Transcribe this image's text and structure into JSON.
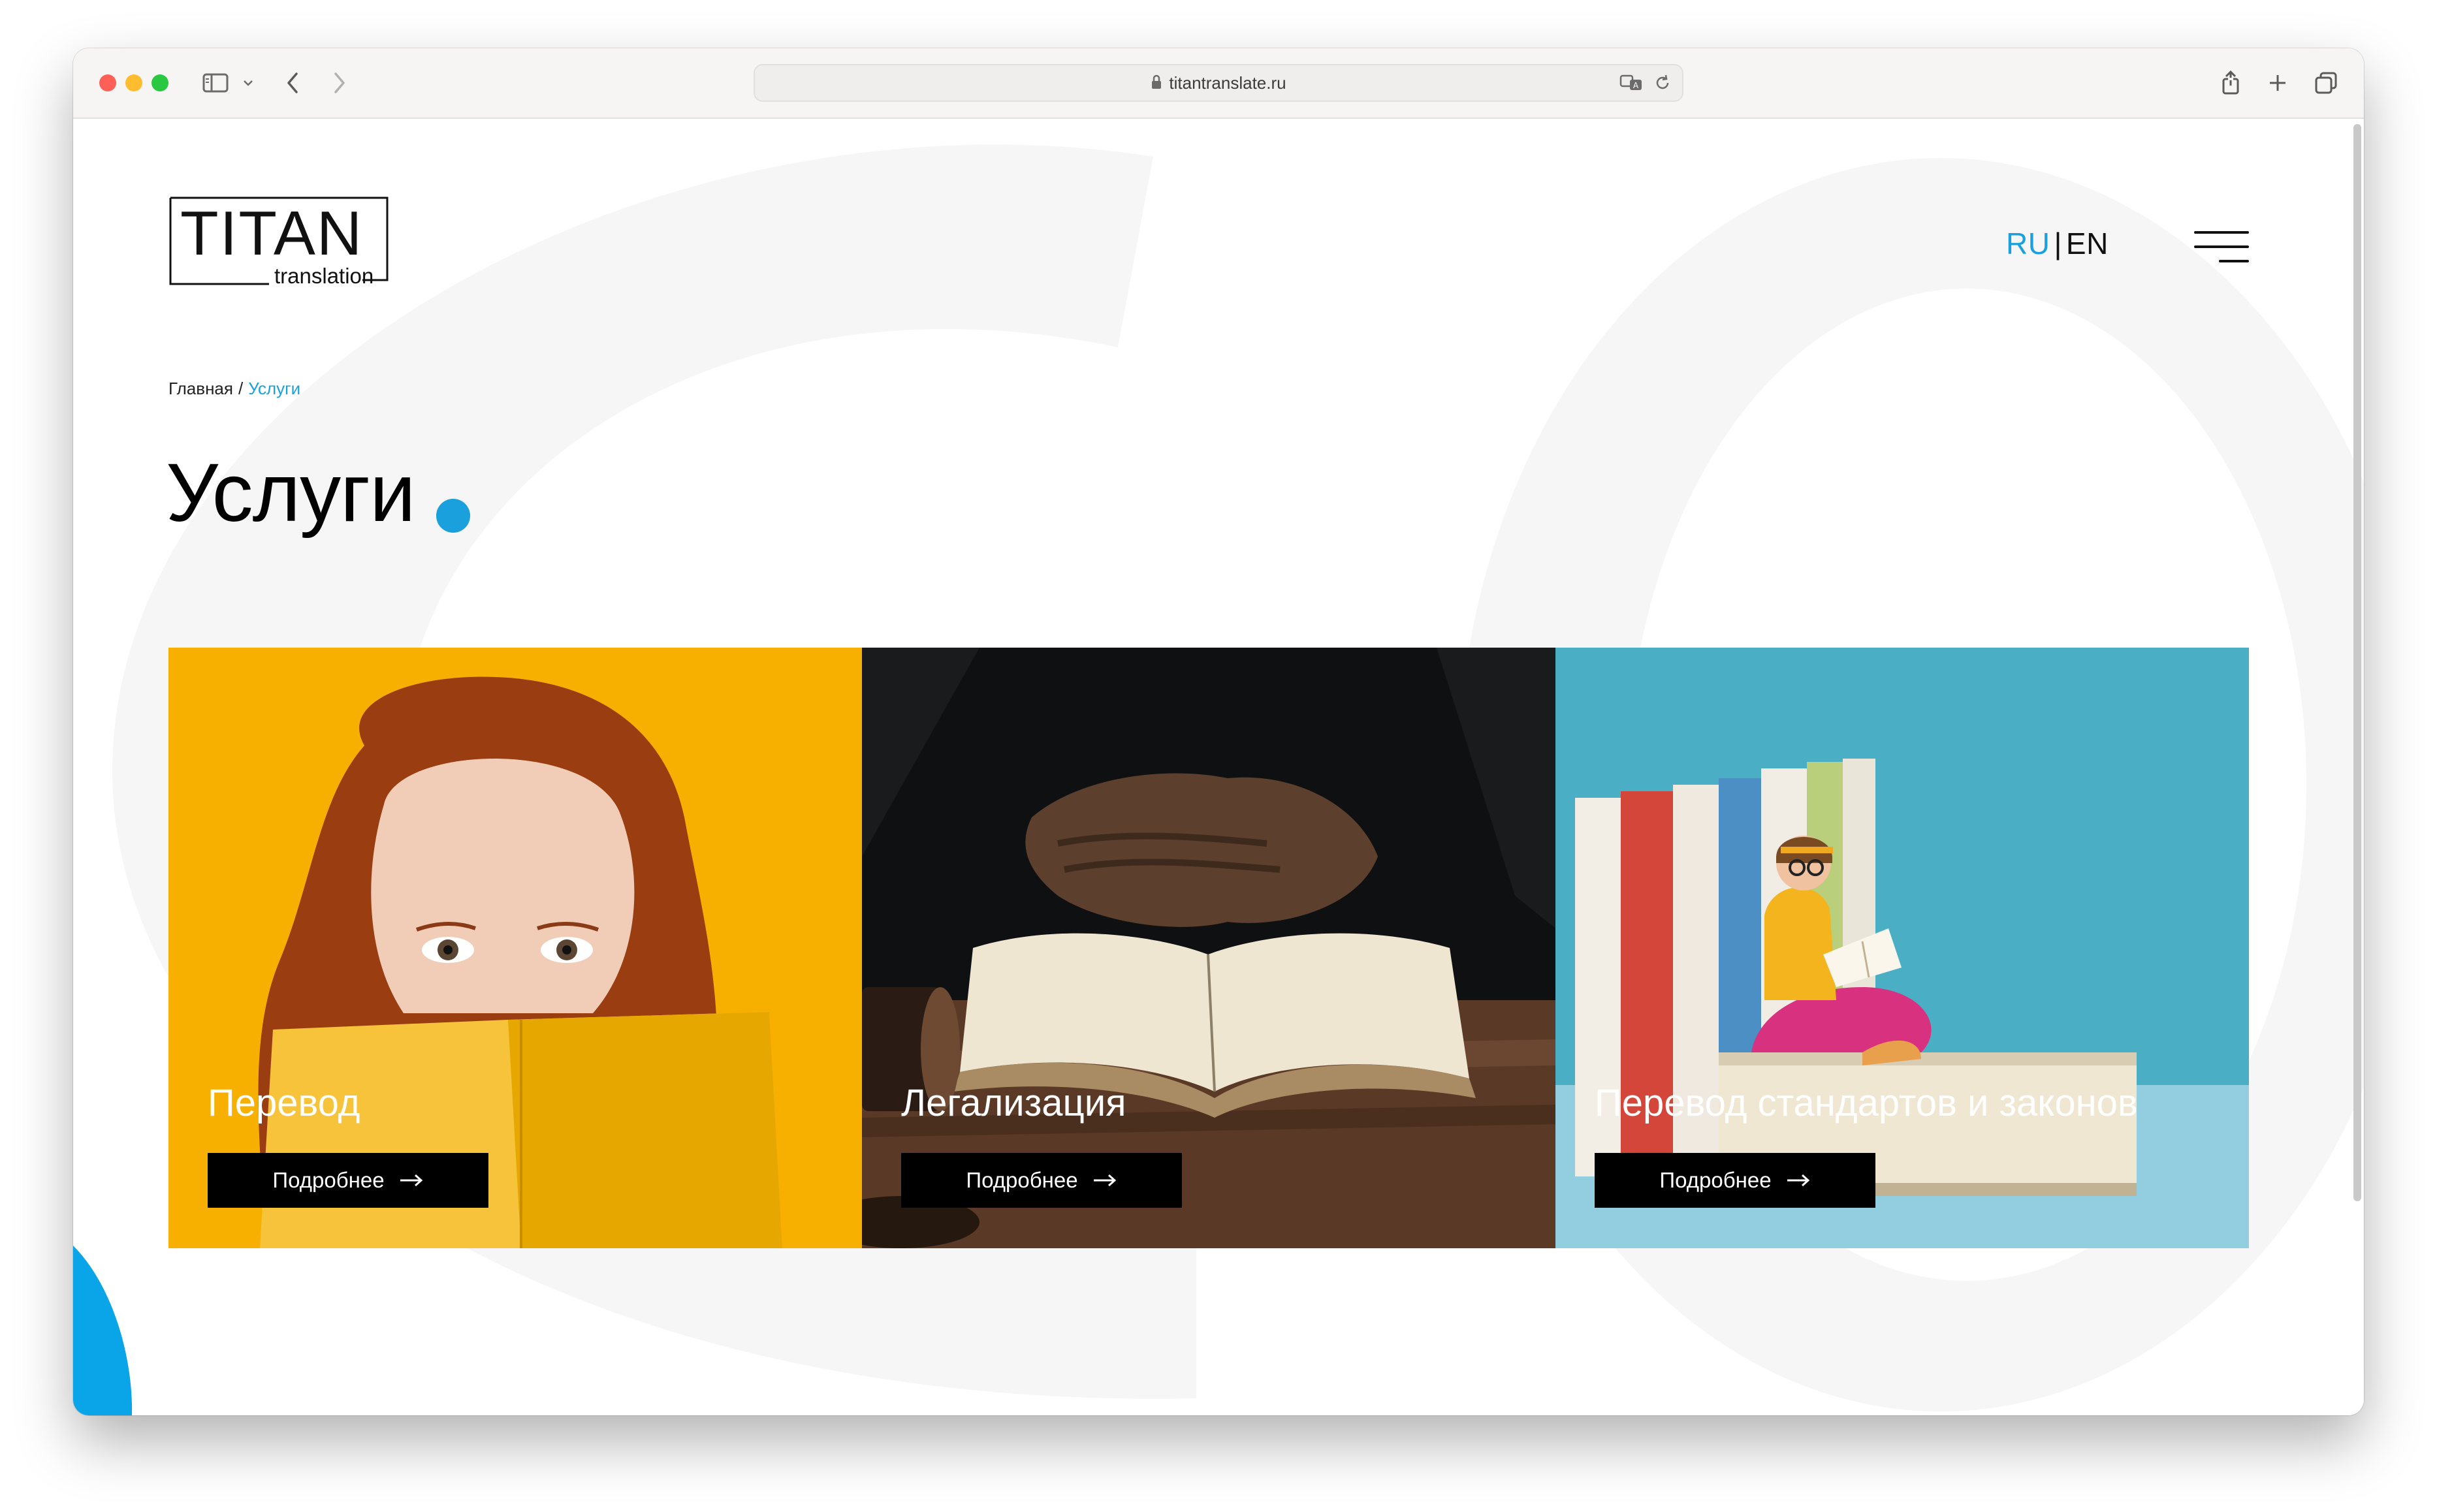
{
  "browser": {
    "url": "titantranslate.ru",
    "icons": [
      "sidebar-icon",
      "chevron-down-icon",
      "back-icon",
      "forward-icon",
      "lock-icon",
      "translate-icon",
      "reload-icon",
      "share-icon",
      "new-tab-icon",
      "tabs-overview-icon"
    ]
  },
  "header": {
    "logo_title": "TITAN",
    "logo_subtitle": "translation",
    "lang_ru": "RU",
    "lang_sep": "|",
    "lang_en": "EN",
    "menu_icon": "hamburger-menu-icon"
  },
  "breadcrumb": {
    "home": "Главная",
    "separator": "/",
    "current": "Услуги"
  },
  "page": {
    "title": "Услуги"
  },
  "cards": [
    {
      "title": "Перевод",
      "button": "Подробнее"
    },
    {
      "title": "Легализация",
      "button": "Подробнее"
    },
    {
      "title": "Перевод стандартов и законов",
      "button": "Подробнее"
    }
  ],
  "colors": {
    "accent": "#1aa0dc",
    "card1_bg": "#f7b000",
    "card2_bg": "#1a1b1d",
    "card3_bg": "#4aaec4",
    "button_bg": "#000000"
  }
}
